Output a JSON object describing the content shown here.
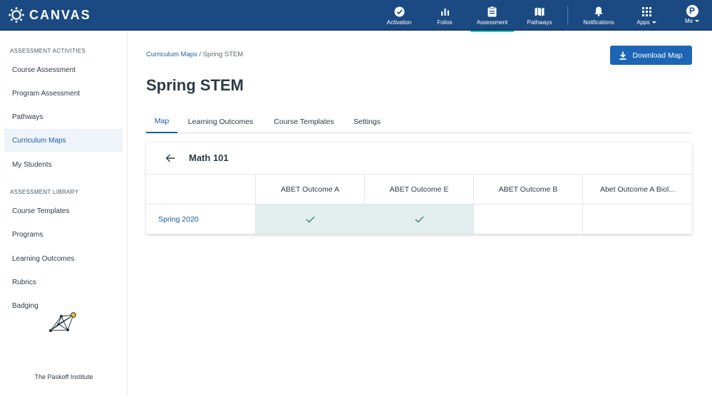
{
  "brand": {
    "name": "CANVAS"
  },
  "nav": {
    "items": [
      {
        "label": "Activation",
        "icon": "check-circle-icon"
      },
      {
        "label": "Folios",
        "icon": "bar-chart-icon"
      },
      {
        "label": "Assessment",
        "icon": "clipboard-icon",
        "active": true
      },
      {
        "label": "Pathways",
        "icon": "map-icon"
      },
      {
        "label": "Notifications",
        "icon": "bell-icon"
      },
      {
        "label": "Apps",
        "icon": "grid-icon"
      },
      {
        "label": "Me",
        "icon": "avatar-icon",
        "avatar_initial": "P"
      }
    ]
  },
  "sidebar": {
    "heading_activities": "ASSESSMENT ACTIVITIES",
    "activities": [
      {
        "label": "Course Assessment"
      },
      {
        "label": "Program Assessment"
      },
      {
        "label": "Pathways"
      },
      {
        "label": "Curriculum Maps",
        "active": true
      },
      {
        "label": "My Students"
      }
    ],
    "heading_library": "ASSESSMENT LIBRARY",
    "library": [
      {
        "label": "Course Templates"
      },
      {
        "label": "Programs"
      },
      {
        "label": "Learning Outcomes"
      },
      {
        "label": "Rubrics"
      },
      {
        "label": "Badging"
      }
    ],
    "institution": "The Paskoff Institute"
  },
  "breadcrumb": {
    "parent": "Curriculum Maps",
    "separator": " / ",
    "current": "Spring STEM"
  },
  "download_button": {
    "label": "Download Map",
    "icon": "download-icon"
  },
  "page_title": "Spring STEM",
  "tabs": [
    {
      "label": "Map",
      "active": true
    },
    {
      "label": "Learning Outcomes"
    },
    {
      "label": "Course Templates"
    },
    {
      "label": "Settings"
    }
  ],
  "map": {
    "course_title": "Math 101",
    "columns": [
      "ABET Outcome A",
      "ABET Outcome E",
      "ABET Outcome B",
      "Abet Outcome A Biol..."
    ],
    "rows": [
      {
        "label": "Spring 2020",
        "mapped": [
          true,
          true,
          false,
          false
        ]
      }
    ]
  },
  "colors": {
    "topbar": "#1b4a82",
    "accent": "#1c5c9e",
    "button": "#1d65b4",
    "active_tab_underline": "#2ec4b6",
    "mapped_cell": "#e3efee",
    "check": "#2a8a67"
  }
}
